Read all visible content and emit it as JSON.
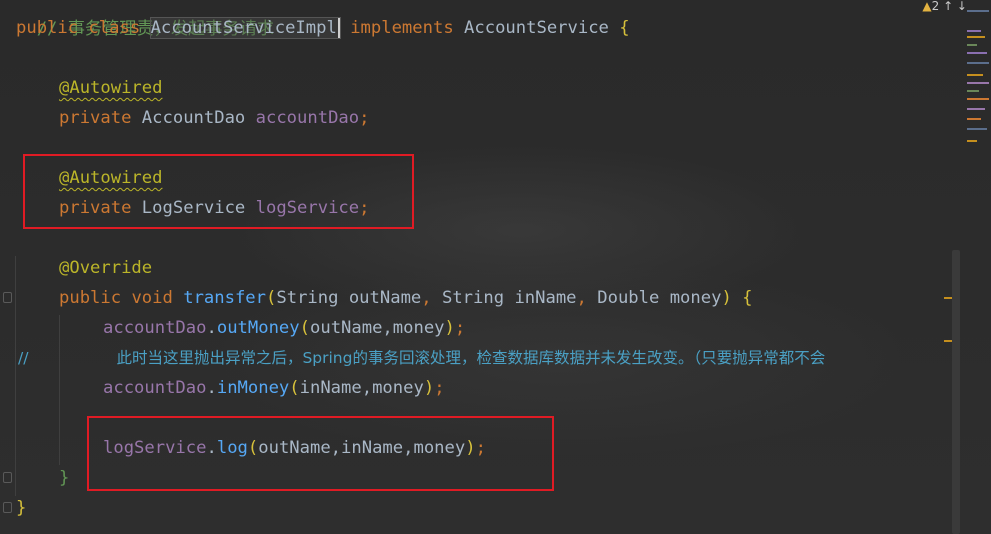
{
  "editor": {
    "language": "java",
    "warnings_count": "2",
    "arrows": "↑ ↓",
    "lines": {
      "comment_top": "// 事务管理责，发起事务请求",
      "class_kw1": "public",
      "class_kw2": "class",
      "class_name": "AccountServiceImpl",
      "implements_kw": "implements",
      "interface_name": "AccountService",
      "open_brace": "{",
      "autowired1": "@Autowired",
      "private1": "private",
      "type1": "AccountDao",
      "field1": "accountDao",
      "semi1": ";",
      "autowired2": "@Autowired",
      "private2": "private",
      "type2": "LogService",
      "field2": "logService",
      "semi2": ";",
      "override": "@Override",
      "m_public": "public",
      "m_void": "void",
      "m_name": "transfer",
      "m_paren_open": "(",
      "p1_type": "String",
      "p1_name": "outName",
      "p2_type": "String",
      "p2_name": "inName",
      "p3_type": "Double",
      "p3_name": "money",
      "m_paren_close": ")",
      "m_brace": "{",
      "call1_obj": "accountDao",
      "call1_method": "outMoney",
      "call1_args": "outName,money",
      "comment_prefix": "//",
      "comment_text": "此时当这里抛出异常之后，Spring的事务回滚处理，检查数据库数据并未发生改变。（只要抛异常都不会",
      "call2_obj": "accountDao",
      "call2_method": "inMoney",
      "call2_args": "inName,money",
      "call3_obj": "logService",
      "call3_method": "log",
      "call3_args": "outName,inName,money",
      "close_method": "}",
      "close_class": "}"
    }
  }
}
